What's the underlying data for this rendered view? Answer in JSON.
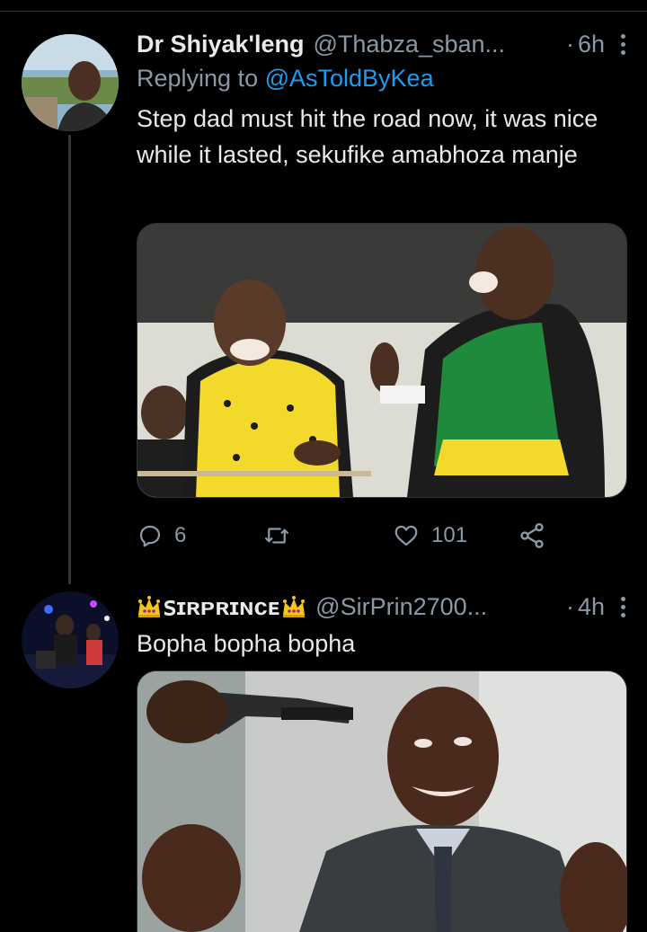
{
  "tweets": [
    {
      "name": "Dr Shiyak'leng",
      "handle": "@Thabza_sban...",
      "dot": "·",
      "time": "6h",
      "replying_prefix": "Replying to ",
      "replying_to": "@AsToldByKea",
      "text": "Step dad must hit the road now, it was nice while it lasted, sekufike amabhoza manje",
      "stats": {
        "replies": "6",
        "retweets": "",
        "likes": "101"
      }
    },
    {
      "name": "ꜱɪʀᴘʀɪɴᴄᴇ",
      "handle": "@SirPrin2700...",
      "dot": "·",
      "time": "4h",
      "text": "Bopha bopha bopha"
    }
  ],
  "colors": {
    "background": "#000000",
    "text": "#e7e9ea",
    "muted": "#8b98a5",
    "link": "#1d9bf0",
    "crown": "#f5c518",
    "anc_green": "#1f8a3c",
    "anc_yellow": "#f2d92c"
  },
  "icons": [
    "reply-icon",
    "retweet-icon",
    "like-icon",
    "share-icon",
    "crown-icon",
    "more-icon"
  ]
}
